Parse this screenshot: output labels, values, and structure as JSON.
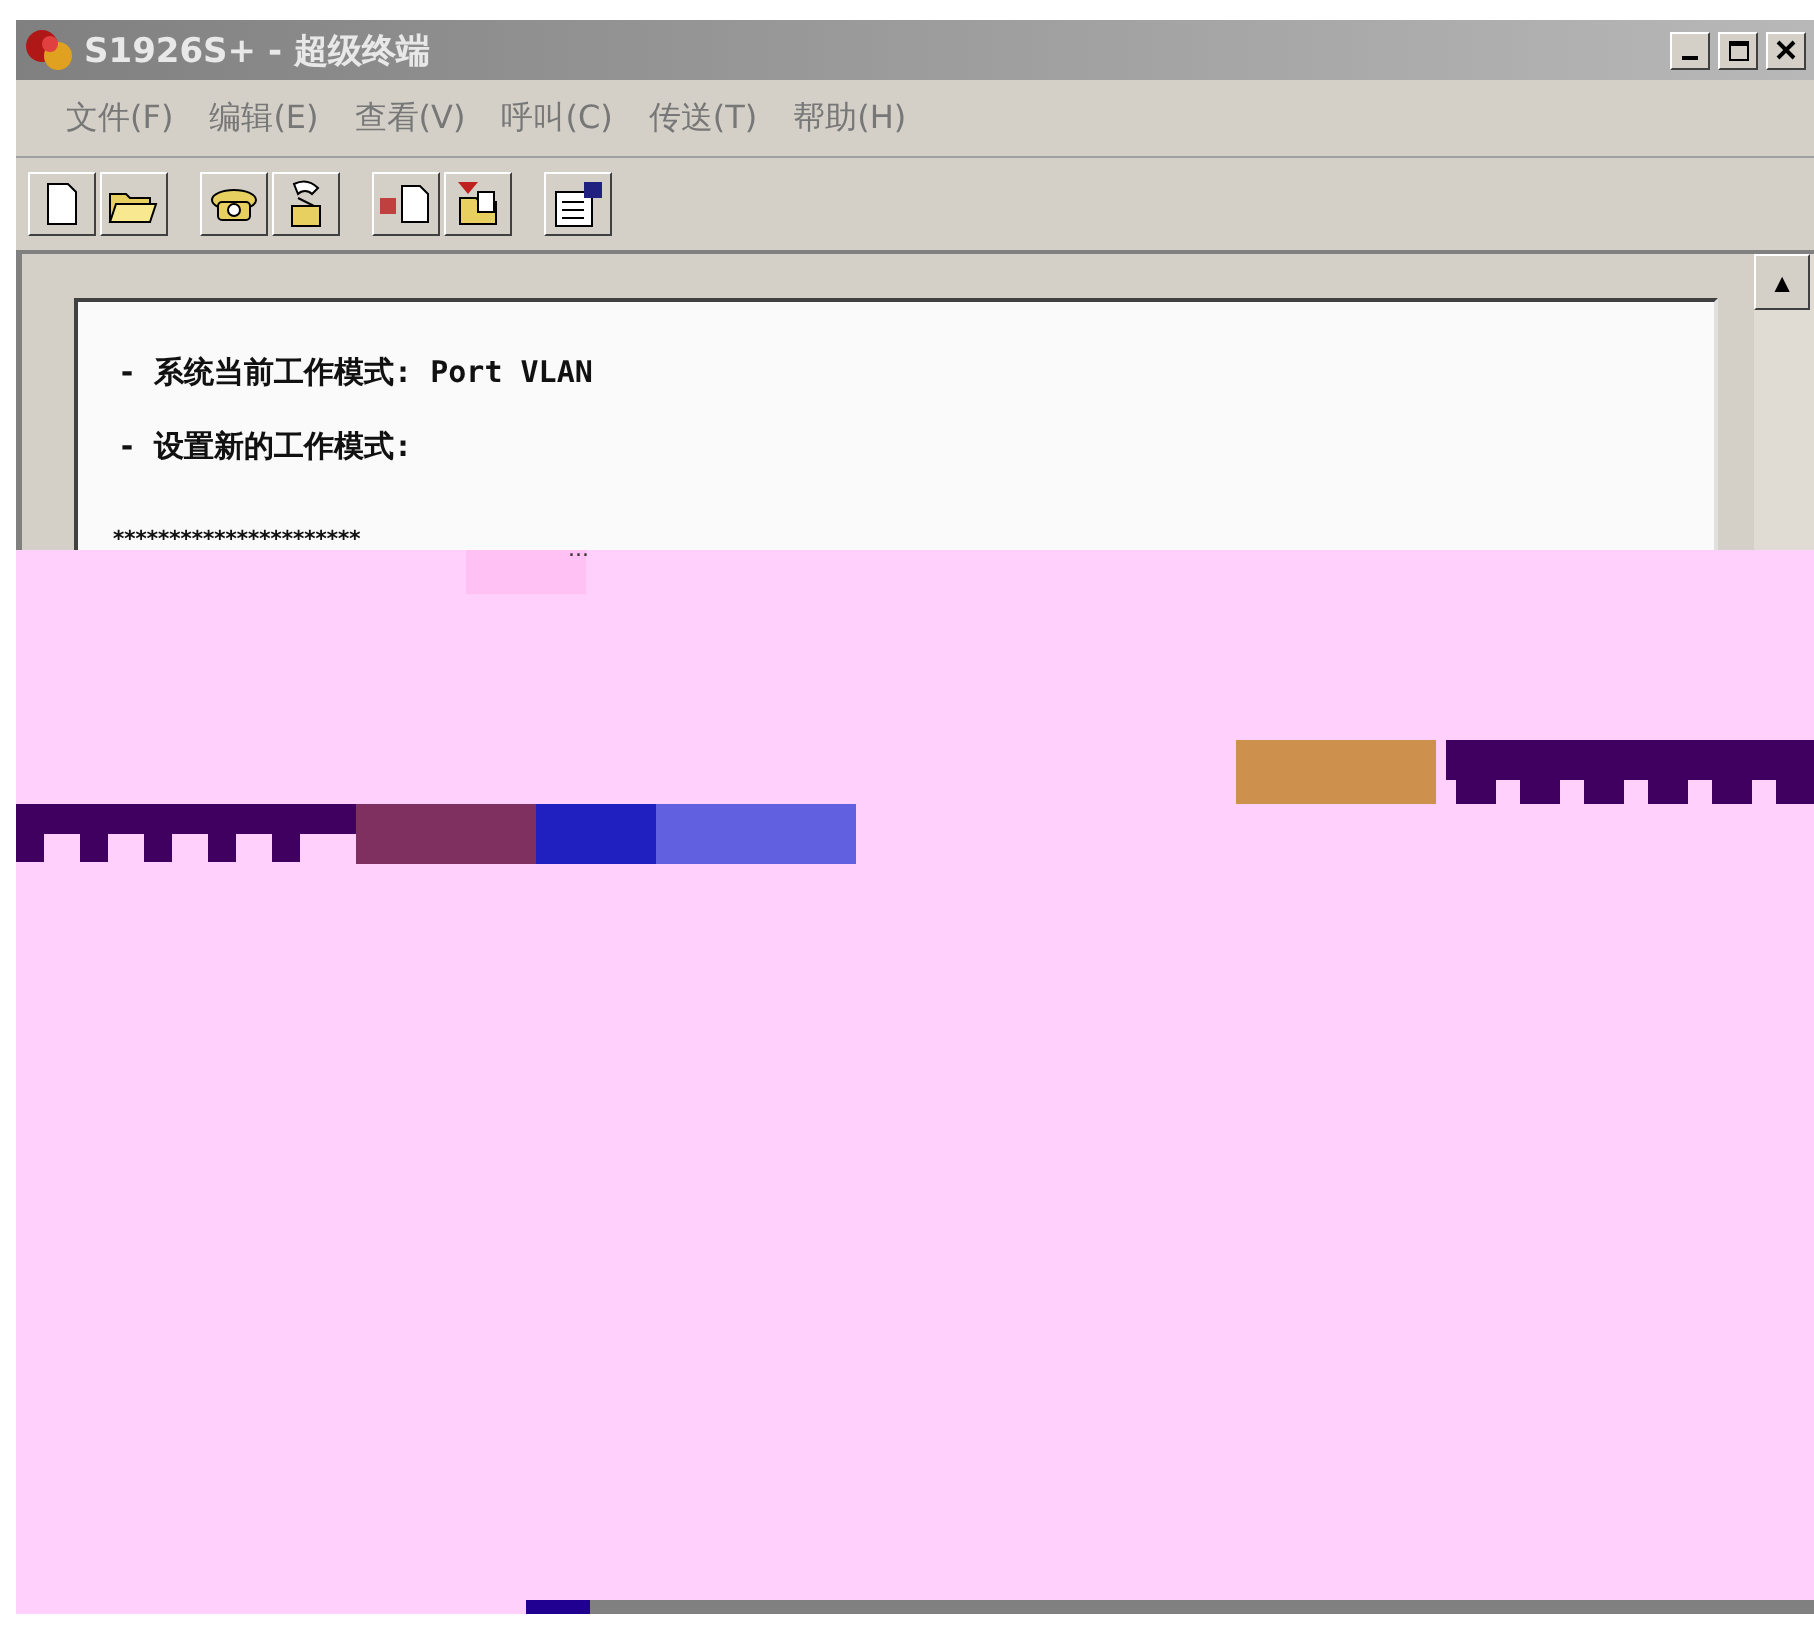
{
  "window": {
    "title": "S1926S+ - 超级终端"
  },
  "menu": [
    "文件(F)",
    "编辑(E)",
    "查看(V)",
    "呼叫(C)",
    "传送(T)",
    "帮助(H)"
  ],
  "terminal": {
    "lines": [
      "- 系统当前工作模式: Port VLAN",
      "- 设置新的工作模式:"
    ],
    "stars": "**********************",
    "ellipsis": "..."
  },
  "scroll_buttons": [
    "▲"
  ]
}
